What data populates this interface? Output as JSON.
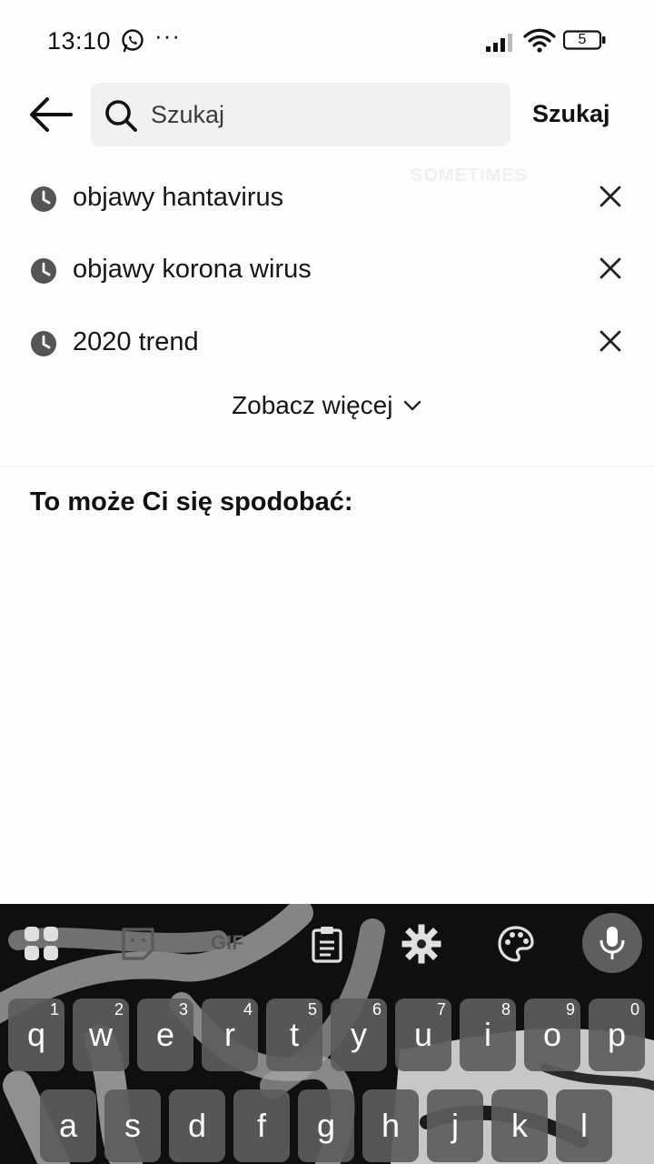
{
  "status_bar": {
    "time": "13:10",
    "notification_icons": [
      "whatsapp-icon"
    ],
    "more": "···",
    "battery": "5"
  },
  "header": {
    "search_placeholder": "Szukaj",
    "search_value": "",
    "search_button": "Szukaj"
  },
  "history": {
    "items": [
      {
        "text": "objawy hantavirus"
      },
      {
        "text": "objawy korona wirus"
      },
      {
        "text": "2020 trend"
      }
    ],
    "see_more": "Zobacz więcej"
  },
  "suggestions": {
    "title": "To może Ci się spodobać:"
  },
  "background_text": "SOMETIMES",
  "keyboard": {
    "toolbar": [
      "apps-grid-icon",
      "sticker-icon",
      "gif-label",
      "clipboard-icon",
      "settings-gear-icon",
      "palette-icon",
      "microphone-icon"
    ],
    "gif_label": "GIF",
    "row1": [
      {
        "char": "q",
        "num": "1"
      },
      {
        "char": "w",
        "num": "2"
      },
      {
        "char": "e",
        "num": "3"
      },
      {
        "char": "r",
        "num": "4"
      },
      {
        "char": "t",
        "num": "5"
      },
      {
        "char": "y",
        "num": "6"
      },
      {
        "char": "u",
        "num": "7"
      },
      {
        "char": "i",
        "num": "8"
      },
      {
        "char": "o",
        "num": "9"
      },
      {
        "char": "p",
        "num": "0"
      }
    ],
    "row2": [
      "a",
      "s",
      "d",
      "f",
      "g",
      "h",
      "j",
      "k",
      "l"
    ]
  }
}
